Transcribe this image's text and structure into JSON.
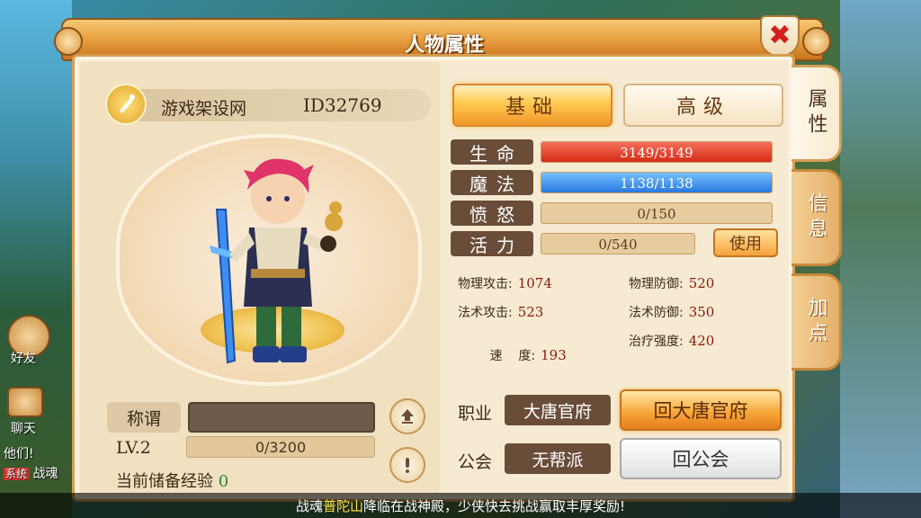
{
  "window": {
    "title": "人物属性"
  },
  "background": {
    "friends_label": "好友",
    "chat_label": "聊天",
    "chat_line_1": "他们!",
    "chat_tag": "系统",
    "chat_line_2": "战魂"
  },
  "profile": {
    "name": "游戏架设网",
    "id": "ID32769"
  },
  "title_row": {
    "label": "称谓",
    "value": ""
  },
  "level": {
    "label": "LV.2",
    "exp_text": "0/3200",
    "exp_fraction": 0
  },
  "reserve_exp": {
    "label": "当前储备经验",
    "value": "0"
  },
  "tabs": {
    "basic": "基础",
    "advanced": "高级"
  },
  "bars": [
    {
      "label": "生命",
      "text": "3149/3149",
      "fraction": 1.0,
      "color": "#d62b16"
    },
    {
      "label": "魔法",
      "text": "1138/1138",
      "fraction": 1.0,
      "color": "#2a78e0"
    },
    {
      "label": "愤怒",
      "text": "0/150",
      "fraction": 0
    },
    {
      "label": "活力",
      "text": "0/540",
      "fraction": 0
    }
  ],
  "use_button": "使用",
  "attributes": {
    "phys_atk_label": "物理攻击:",
    "phys_atk": "1074",
    "phys_def_label": "物理防御:",
    "phys_def": "520",
    "magic_atk_label": "法术攻击:",
    "magic_atk": "523",
    "magic_def_label": "法术防御:",
    "magic_def": "350",
    "speed_label": "速    度:",
    "speed": "193",
    "heal_label": "治疗强度:",
    "heal": "420"
  },
  "profession": {
    "label": "职业",
    "value": "大唐官府",
    "button": "回大唐官府"
  },
  "guild": {
    "label": "公会",
    "value": "无帮派",
    "button": "回公会"
  },
  "side_tabs": [
    "属性",
    "信息",
    "加点"
  ],
  "marquee": {
    "prefix": "战魂",
    "highlight": "普陀山",
    "suffix": "降临在战神殿，少侠快去挑战赢取丰厚奖励!"
  }
}
